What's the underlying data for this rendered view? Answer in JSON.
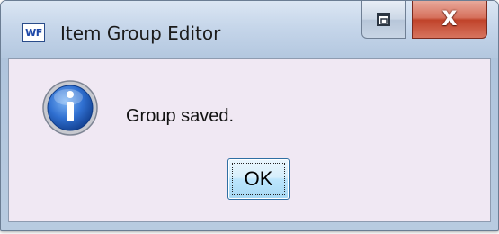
{
  "window": {
    "title": "Item Group Editor",
    "app_icon_text": "WF",
    "close_glyph": "X",
    "icons": {
      "app": "wf-app-icon",
      "restore": "restore-icon",
      "close": "close-icon",
      "message": "info-icon"
    }
  },
  "dialog": {
    "message": "Group saved.",
    "ok_label": "OK"
  },
  "colors": {
    "content_background": "#f0e8f3",
    "close_button": "#c0432a",
    "info_icon": "#1e56b5"
  }
}
